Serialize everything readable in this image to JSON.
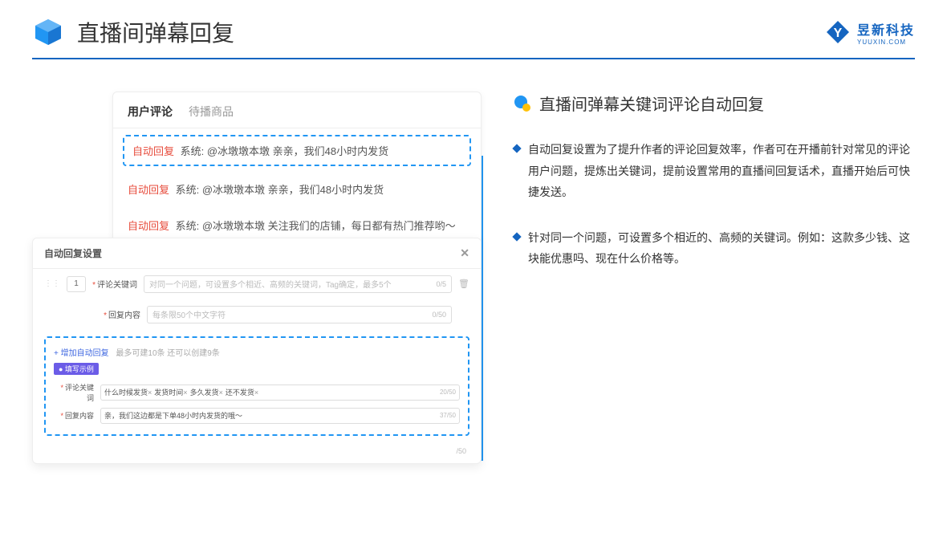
{
  "header": {
    "title": "直播间弹幕回复",
    "brand_name": "昱新科技",
    "brand_sub": "YUUXIN.COM"
  },
  "comments": {
    "tab_active": "用户评论",
    "tab_inactive": "待播商品",
    "highlighted": {
      "badge": "自动回复",
      "text": "系统: @冰墩墩本墩 亲亲，我们48小时内发货"
    },
    "items": [
      {
        "badge": "自动回复",
        "text": "系统: @冰墩墩本墩 亲亲，我们48小时内发货"
      },
      {
        "badge": "自动回复",
        "text": "系统: @冰墩墩本墩 关注我们的店铺，每日都有热门推荐哟～"
      }
    ]
  },
  "settings": {
    "title": "自动回复设置",
    "num": "1",
    "keyword_label": "评论关键词",
    "keyword_placeholder": "对同一个问题，可设置多个相近、高频的关键词，Tag确定，最多5个",
    "keyword_count": "0/5",
    "reply_label": "回复内容",
    "reply_placeholder": "每条限50个中文字符",
    "reply_count": "0/50",
    "add_link": "+ 增加自动回复",
    "add_sub": "最多可建10条 还可以创建9条",
    "example_badge": "● 填写示例",
    "ex_keyword_label": "评论关键词",
    "ex_tags": [
      "什么时候发货",
      "发货时间",
      "多久发货",
      "还不发货"
    ],
    "ex_keyword_count": "20/50",
    "ex_reply_label": "回复内容",
    "ex_reply_text": "亲，我们这边都是下单48小时内发货的哦～",
    "ex_reply_count": "37/50",
    "outer_count": "/50"
  },
  "right": {
    "section_title": "直播间弹幕关键词评论自动回复",
    "bullets": [
      "自动回复设置为了提升作者的评论回复效率，作者可在开播前针对常见的评论用户问题，提炼出关键词，提前设置常用的直播间回复话术，直播开始后可快捷发送。",
      "针对同一个问题，可设置多个相近的、高频的关键词。例如：这款多少钱、这块能优惠吗、现在什么价格等。"
    ]
  }
}
